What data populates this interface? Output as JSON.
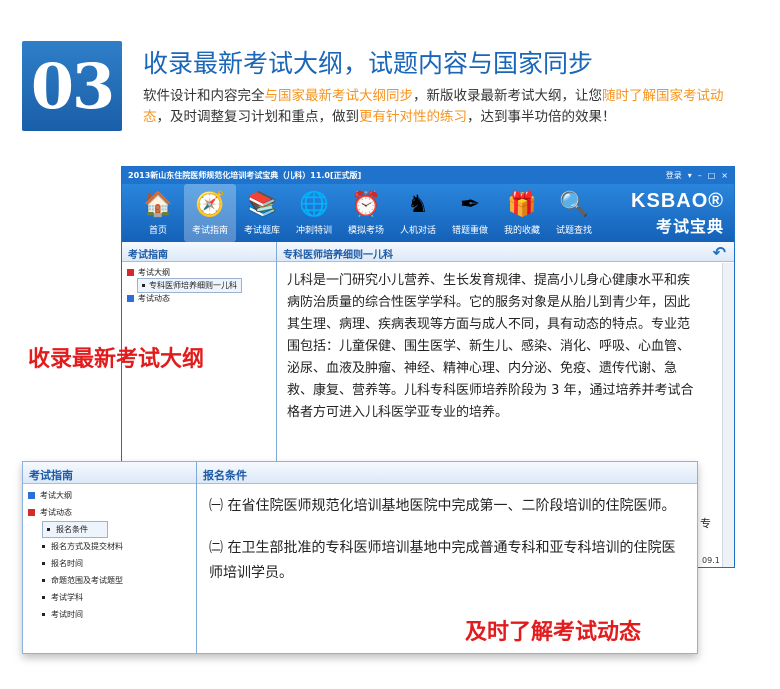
{
  "banner": {
    "number": "03",
    "headline": "收录最新考试大纲，试题内容与国家同步",
    "desc_parts": [
      "软件设计和内容完全",
      "与国家最新考试大纲同步",
      "，新版收录最新考试大纲，让您",
      "随时了解国家考试动态",
      "，及时调整复习计划和重点，做到",
      "更有针对性的练习",
      "，达到事半功倍的效果！"
    ]
  },
  "window": {
    "title": "2013新山东住院医师规范化培训考试宝典（儿科）11.0[正式版]",
    "login": "登录",
    "controls": [
      "▾",
      "–",
      "□",
      "×"
    ],
    "toolbar": [
      {
        "label": "首页",
        "icon": "home-icon",
        "glyph": "🏠"
      },
      {
        "label": "考试指南",
        "icon": "compass-icon",
        "glyph": "🧭"
      },
      {
        "label": "考试题库",
        "icon": "books-icon",
        "glyph": "📚"
      },
      {
        "label": "冲刺特训",
        "icon": "globe-icon",
        "glyph": "🌐"
      },
      {
        "label": "模拟考场",
        "icon": "clock-icon",
        "glyph": "⏰"
      },
      {
        "label": "人机对话",
        "icon": "chess-icon",
        "glyph": "♞"
      },
      {
        "label": "错题重做",
        "icon": "pen-icon",
        "glyph": "✒"
      },
      {
        "label": "我的收藏",
        "icon": "gift-icon",
        "glyph": "🎁"
      },
      {
        "label": "试题查找",
        "icon": "search-icon",
        "glyph": "🔍"
      }
    ],
    "brand_top": "KSBAO®",
    "brand_bottom": "考试宝典",
    "sidebar": {
      "title": "考试指南",
      "items": [
        "考试大纲",
        "专科医师培养细则一儿科",
        "考试动态"
      ]
    },
    "content": {
      "title": "专科医师培养细则一儿科",
      "body": "儿科是一门研究小儿营养、生长发育规律、提高小儿身心健康水平和疾病防治质量的综合性医学学科。它的服务对象是从胎儿到青少年，因此其生理、病理、疾病表现等方面与成人不同，具有动态的特点。专业范围包括：儿童保健、围生医学、新生儿、感染、消化、呼吸、心血管、泌尿、血液及肿瘤、神经、精神心理、内分泌、免疫、遗传代谢、急救、康复、营养等。儿科专科医师培养阶段为 3 年，通过培养并考试合格者方可进入儿科医学亚专业的培养。"
    },
    "version": "09.1",
    "edge_char": "专"
  },
  "overlay1": "收录最新考试大纲",
  "panel2": {
    "sidebar_title": "考试指南",
    "items": [
      "考试大纲",
      "考试动态"
    ],
    "leaves": [
      "报名条件",
      "报名方式及提交材料",
      "报名时间",
      "命题范围及考试题型",
      "考试学科",
      "考试时间"
    ],
    "content_title": "报名条件",
    "para1": "㈠ 在省住院医师规范化培训基地医院中完成第一、二阶段培训的住院医师。",
    "para2": "㈡ 在卫生部批准的专科医师培训基地中完成普通专科和亚专科培训的住院医师培训学员。"
  },
  "overlay2": "及时了解考试动态",
  "colors": {
    "accent": "#1f73cc",
    "highlight": "#f7941d",
    "red": "#e21c1c"
  }
}
